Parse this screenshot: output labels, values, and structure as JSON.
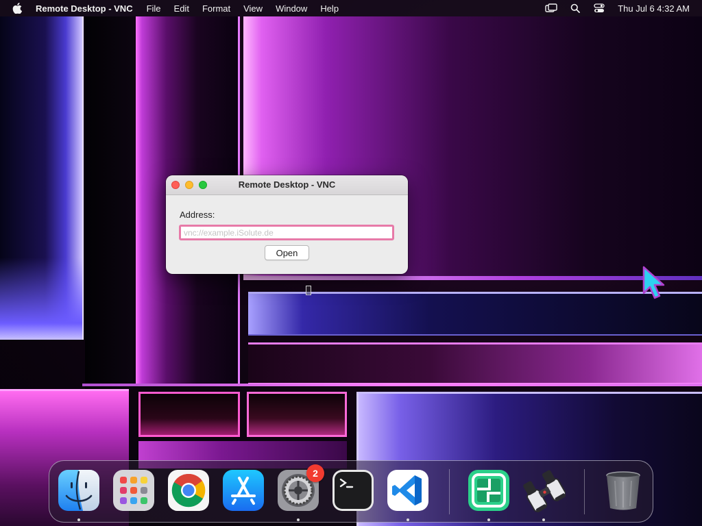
{
  "menubar": {
    "app_name": "Remote Desktop - VNC",
    "menus": [
      "File",
      "Edit",
      "Format",
      "View",
      "Window",
      "Help"
    ],
    "clock": "Thu Jul 6  4:32 AM",
    "status_icons": [
      "screen-mirroring-icon",
      "search-icon",
      "control-center-icon"
    ]
  },
  "window": {
    "title": "Remote Desktop - VNC",
    "address_label": "Address:",
    "address_placeholder": "vnc://example.iSolute.de",
    "address_value": "",
    "open_button": "Open"
  },
  "dock": {
    "apps": [
      {
        "name": "Finder",
        "icon": "finder-icon",
        "running": true
      },
      {
        "name": "Launchpad",
        "icon": "launchpad-icon",
        "running": false
      },
      {
        "name": "Google Chrome",
        "icon": "chrome-icon",
        "running": false
      },
      {
        "name": "App Store",
        "icon": "app-store-icon",
        "running": false
      },
      {
        "name": "System Settings",
        "icon": "system-settings-icon",
        "running": true,
        "badge": "2"
      },
      {
        "name": "Terminal",
        "icon": "terminal-icon",
        "running": false
      },
      {
        "name": "Visual Studio Code",
        "icon": "vscode-icon",
        "running": true
      },
      {
        "name": "Remote Desktop - VNC",
        "icon": "remote-desktop-icon",
        "running": true
      },
      {
        "name": "Binoculars",
        "icon": "binoculars-icon",
        "running": true
      },
      {
        "name": "Trash",
        "icon": "trash-icon",
        "running": false
      }
    ]
  },
  "colors": {
    "focus_ring": "#e77aa8",
    "badge": "#f23b30",
    "close": "#fe5f57",
    "minimize": "#febc2e",
    "maximize": "#28c840",
    "cursor": "#2fd0f0"
  }
}
